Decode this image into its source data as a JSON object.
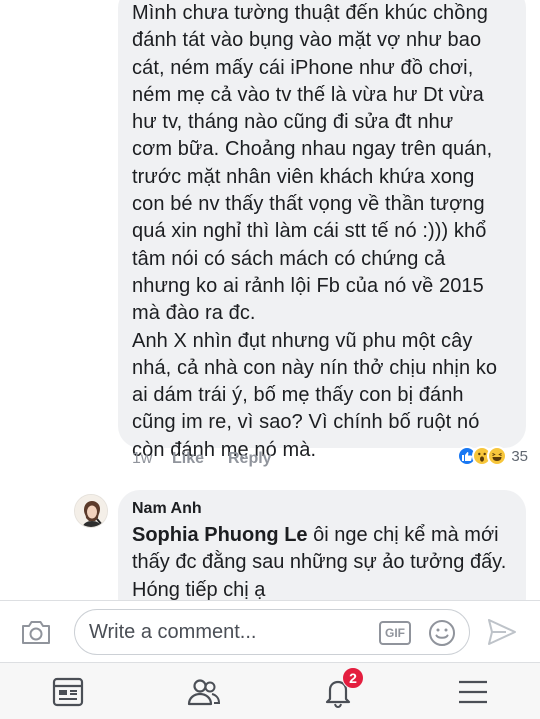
{
  "comment": {
    "text": "Mình chưa tường thuật đến khúc chồng\nđánh tát vào bụng vào mặt vợ như bao\ncát, ném mấy cái iPhone như đồ chơi,\nném mẹ cả vào tv thế là vừa hư Dt vừa\như tv, tháng nào cũng đi sửa đt như\ncơm bữa. Choảng nhau ngay trên quán,\ntrước mặt nhân viên khách khứa xong\ncon bé nv thấy thất vọng về thần tượng\nquá xin nghỉ thì làm cái stt tế nó :))) khổ\ntâm nói có sách mách có chứng cả\nnhưng ko ai rảnh lội Fb của nó về 2015\nmà đào ra đc.\nAnh X nhìn đụt nhưng vũ phu một cây\nnhá, cả nhà con này nín thở chịu nhịn ko\nai dám trái ý, bố mẹ thấy con bị đánh\ncũng im re, vì sao? Vì chính bố ruột nó\ncòn đánh mẹ nó mà.",
    "time": "1w",
    "like_label": "Like",
    "reply_label": "Reply",
    "reaction_count": "35",
    "reactions": [
      "like-icon",
      "wow-icon",
      "haha-icon"
    ]
  },
  "reply": {
    "author": "Nam Anh",
    "mention": "Sophia Phuong Le",
    "text_line1_rest": " ôi nge chị kể mà mới",
    "text_rest": "thấy đc đằng sau những sự ảo tưởng đấy. Hóng tiếp chị ạ"
  },
  "composer": {
    "placeholder": "Write a comment...",
    "gif_label": "GIF"
  },
  "tabbar": {
    "notifications_badge": "2",
    "tabs": [
      "news-feed-icon",
      "friends-icon",
      "notifications-icon",
      "menu-icon"
    ]
  },
  "colors": {
    "bubble": "#f0f1f3",
    "like_blue": "#1877f2",
    "badge_red": "#e41e3f",
    "meta_gray": "#90949c"
  }
}
